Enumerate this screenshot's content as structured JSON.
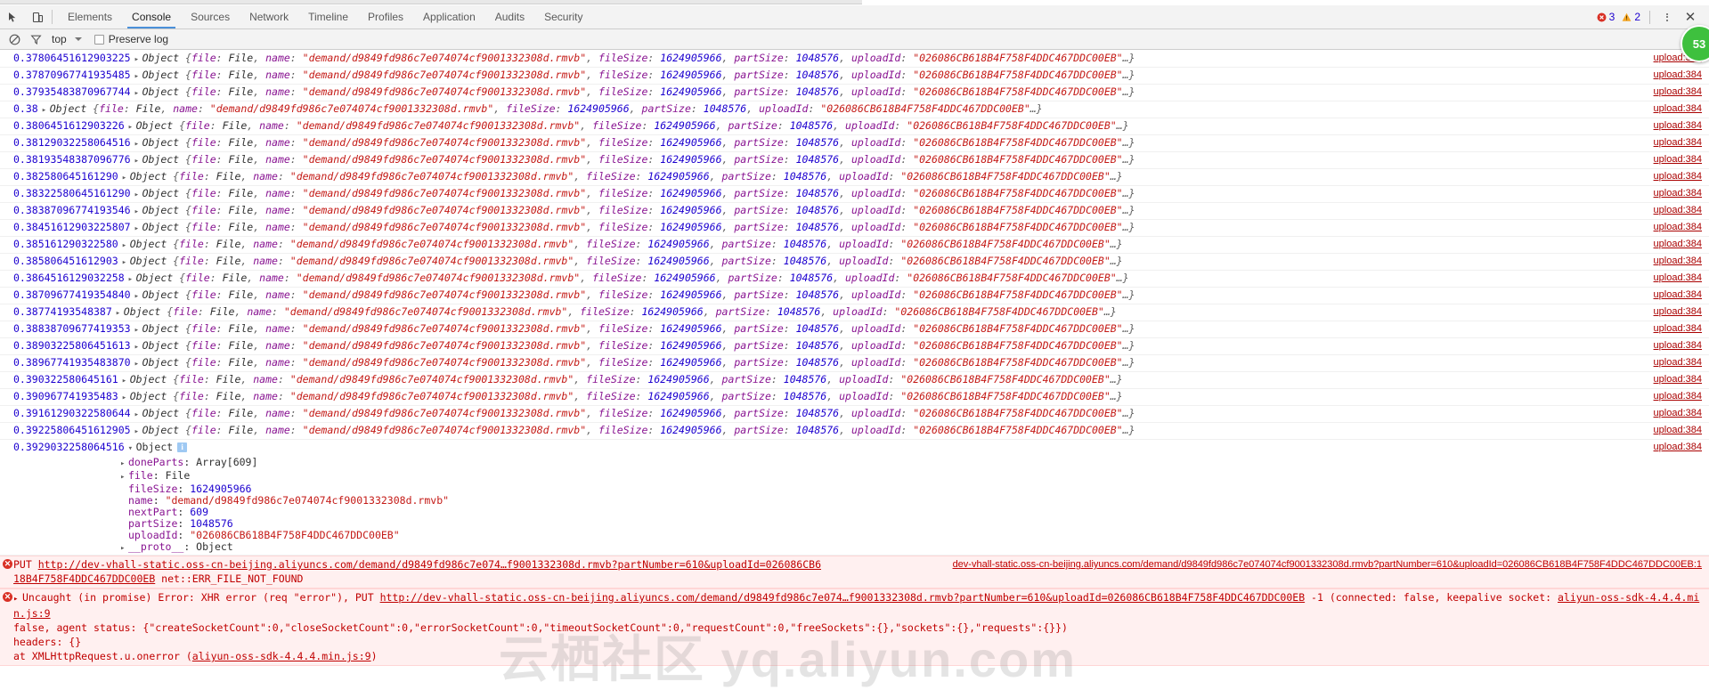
{
  "devtools": {
    "tabs": [
      {
        "label": "Elements",
        "active": false
      },
      {
        "label": "Console",
        "active": true
      },
      {
        "label": "Sources",
        "active": false
      },
      {
        "label": "Network",
        "active": false
      },
      {
        "label": "Timeline",
        "active": false
      },
      {
        "label": "Profiles",
        "active": false
      },
      {
        "label": "Application",
        "active": false
      },
      {
        "label": "Audits",
        "active": false
      },
      {
        "label": "Security",
        "active": false
      }
    ],
    "inspect_icon": "inspect-element-icon",
    "device_icon": "toggle-device-toolbar-icon",
    "error_count": "3",
    "warning_count": "2",
    "error_icon": "error-circle-icon",
    "warning_icon": "warning-triangle-icon",
    "kebab_icon": "more-options-icon",
    "close_icon": "close-icon"
  },
  "filterbar": {
    "clear_icon": "clear-console-icon",
    "filter_icon": "filter-funnel-icon",
    "context": "top",
    "context_caret_icon": "chevron-down-icon",
    "preserve_log_label": "Preserve log",
    "preserve_log_checked": false
  },
  "console": {
    "source_link": "upload:384",
    "object_label": "Object",
    "file_value": "File",
    "keys": {
      "file": "file",
      "name": "name",
      "fileSize": "fileSize",
      "partSize": "partSize",
      "uploadId": "uploadId",
      "doneParts": "doneParts",
      "nextPart": "nextPart",
      "proto": "__proto__"
    },
    "values": {
      "name": "\"demand/d9849fd986c7e074074cf9001332308d.rmvb\"",
      "fileSize": "1624905966",
      "partSize": "1048576",
      "uploadId_truncated": "\"026086CB618B4F758F4DDC467DDC00EB\"",
      "uploadId_full": "\"026086CB618B4F758F4DDC467DDC00EB\"",
      "doneParts": "Array[609]",
      "nextPart": "609",
      "name_plain": "\"demand/d9849fd986c7e074074cf9001332308d.rmvb\"",
      "fileSize_plain": "1624905966",
      "partSize_plain": "1048576",
      "proto": "Object"
    },
    "ellipsis": "…}",
    "collapsed_rows": [
      {
        "progress": "0.37806451612903225",
        "truncated": true
      },
      {
        "progress": "0.37870967741935485",
        "truncated": true
      },
      {
        "progress": "0.37935483870967744",
        "truncated": false
      },
      {
        "progress": "0.38",
        "truncated": false
      },
      {
        "progress": "0.3806451612903226",
        "truncated": true
      },
      {
        "progress": "0.38129032258064516",
        "truncated": true
      },
      {
        "progress": "0.38193548387096776",
        "truncated": true
      },
      {
        "progress": "0.382580645161290",
        "truncated": false
      },
      {
        "progress": "0.38322580645161290",
        "truncated": false
      },
      {
        "progress": "0.38387096774193546",
        "truncated": true
      },
      {
        "progress": "0.38451612903225807",
        "truncated": true
      },
      {
        "progress": "0.385161290322580",
        "truncated": false
      },
      {
        "progress": "0.385806451612903",
        "truncated": false
      },
      {
        "progress": "0.3864516129032258",
        "truncated": true
      },
      {
        "progress": "0.38709677419354840",
        "truncated": true
      },
      {
        "progress": "0.38774193548387",
        "truncated": false
      },
      {
        "progress": "0.38838709677419353",
        "truncated": false
      },
      {
        "progress": "0.38903225806451613",
        "truncated": false
      },
      {
        "progress": "0.38967741935483870",
        "truncated": false
      },
      {
        "progress": "0.390322580645161",
        "truncated": false
      },
      {
        "progress": "0.390967741935483",
        "truncated": false
      },
      {
        "progress": "0.39161290322580644",
        "truncated": false
      },
      {
        "progress": "0.39225806451612905",
        "truncated": false
      }
    ],
    "expanded_row": {
      "progress": "0.3929032258064516",
      "info_badge": "i"
    }
  },
  "errors": [
    {
      "icon": "error-circle-icon",
      "method": "PUT",
      "url_display": "http://dev-vhall-static.oss-cn-beijing.aliyuncs.com/demand/d9849fd986c7e074…f9001332308d.rmvb?partNumber=610&uploadId=026086CB6",
      "url_wrap": "18B4F758F4DDC467DDC00EB",
      "net_error": "net::ERR_FILE_NOT_FOUND",
      "source": "dev-vhall-static.oss-cn-beijing.aliyuncs.com/demand/d9849fd986c7e074074cf9001332308d.rmvb?partNumber=610&uploadId=026086CB618B4F758F4DDC467DDC00EB:1"
    },
    {
      "icon": "error-circle-icon",
      "disclosure": "▶",
      "prefix": "Uncaught (in promise) Error: XHR error (req \"error\"), PUT ",
      "url_inline": "http://dev-vhall-static.oss-cn-beijing.aliyuncs.com/demand/d9849fd986c7e074…f9001332308d.rmvb?partNumber=610&uploadId=026086CB618B4F758F4DDC467DDC00EB",
      "suffix1": " -1 (connected: false, keepalive socket: ",
      "line2": "false, agent status: {\"createSocketCount\":0,\"closeSocketCount\":0,\"errorSocketCount\":0,\"timeoutSocketCount\":0,\"requestCount\":0,\"freeSockets\":{},\"sockets\":{},\"requests\":{}})",
      "line3": "headers: {}",
      "line4_prefix": "    at XMLHttpRequest.u.onerror (",
      "line4_link": "aliyun-oss-sdk-4.4.4.min.js:9",
      "line4_suffix": ")",
      "source": "aliyun-oss-sdk-4.4.4.min.js:9"
    }
  ],
  "watermark": "云栖社区 yq.aliyun.com",
  "side_badge": "53",
  "colors": {
    "accent": "#4a90d9",
    "error": "#d93025",
    "error_bg": "#fff0f0",
    "warning": "#f5a623",
    "badge_green": "#3ec03e",
    "string_red": "#c41a16",
    "key_purple": "#881391",
    "number_blue": "#1c00cf",
    "toolbar_bg": "#f3f3f3"
  }
}
